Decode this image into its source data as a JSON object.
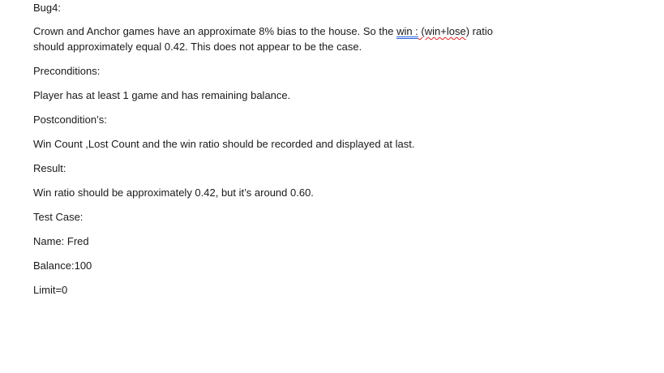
{
  "doc": {
    "title": "Bug4:",
    "intro": {
      "part1": "Crown and Anchor games have an approximate 8% bias to the house. So the ",
      "win_term": "win :",
      "part2": " (win+",
      "lose_term": "lose",
      "part3": ") ratio",
      "line2": "should approximately equal 0.42. This does not appear to be the case."
    },
    "preconditions_label": "Preconditions:",
    "preconditions_text": "Player has at least 1 game and has remaining balance.",
    "postconditions_label": "Postcondition’s:",
    "postconditions_text": "Win Count ,Lost Count and the win ratio should be recorded and displayed at last.",
    "result_label": "Result:",
    "result_text": "Win ratio should be approximately 0.42, but it’s around 0.60.",
    "test_case_label": "Test Case:",
    "name_line": "Name: Fred",
    "balance_line": "Balance:100",
    "limit_line": "Limit=0"
  }
}
